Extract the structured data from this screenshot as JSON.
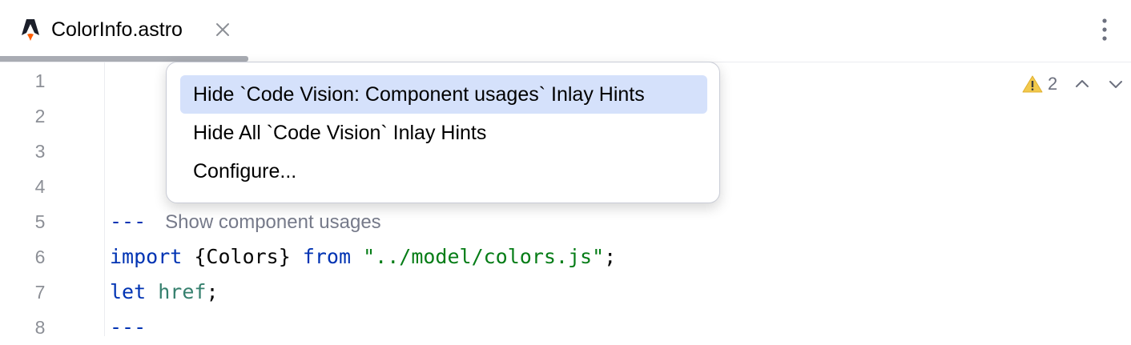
{
  "tab": {
    "title": "ColorInfo.astro",
    "logo_icon": "astro-logo-icon",
    "close_icon": "close-icon"
  },
  "toolbar": {
    "more_icon": "more-vertical-icon"
  },
  "gutter": {
    "line_numbers": [
      "1",
      "2",
      "3",
      "4",
      "5",
      "6",
      "7",
      "8"
    ]
  },
  "inspection": {
    "warning_count": "2",
    "icons": [
      "warning-icon",
      "chevron-up-icon",
      "chevron-down-icon"
    ]
  },
  "code": {
    "line5_delim": "---",
    "line5_hint": "Show component usages",
    "line6_import": "import",
    "line6_braces": " {Colors} ",
    "line6_from": "from",
    "line6_string": "\"../model/colors.js\"",
    "line6_semicolon": ";",
    "line7_let": "let",
    "line7_var": "href",
    "line7_semicolon": ";",
    "line8_delim": "---"
  },
  "popup_menu": {
    "items": [
      "Hide `Code Vision: Component usages` Inlay Hints",
      "Hide All `Code Vision` Inlay Hints",
      "Configure..."
    ],
    "selected_index": 0
  },
  "colors": {
    "keyword": "#0033b3",
    "string": "#067d17",
    "selection": "#d5e1fb",
    "warning": "#f2c94c"
  }
}
